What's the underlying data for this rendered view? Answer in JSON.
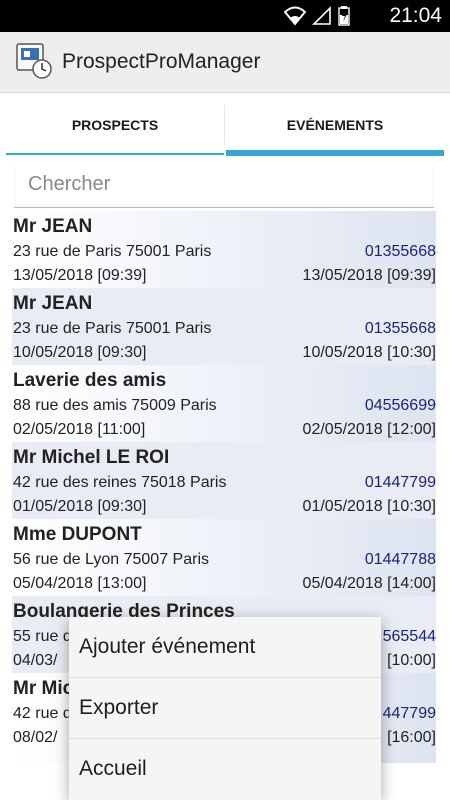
{
  "status_bar": {
    "time": "21:04",
    "icons": [
      "wifi-icon",
      "signal-icon",
      "battery-icon"
    ]
  },
  "app": {
    "title": "ProspectProManager"
  },
  "tabs": [
    {
      "label": "PROSPECTS",
      "selected": false
    },
    {
      "label": "EVÉNEMENTS",
      "selected": true
    }
  ],
  "search": {
    "placeholder": "Chercher",
    "value": ""
  },
  "events": [
    {
      "name": "Mr JEAN",
      "address": "23 rue de Paris 75001 Paris",
      "phone": "01355668",
      "start": "13/05/2018  [09:39]",
      "end": "13/05/2018  [09:39]"
    },
    {
      "name": "Mr JEAN",
      "address": "23 rue de Paris 75001 Paris",
      "phone": "01355668",
      "start": "10/05/2018  [09:30]",
      "end": "10/05/2018  [10:30]"
    },
    {
      "name": "Laverie des amis",
      "address": "88 rue des amis 75009 Paris",
      "phone": "04556699",
      "start": "02/05/2018  [11:00]",
      "end": "02/05/2018  [12:00]"
    },
    {
      "name": "Mr Michel LE ROI",
      "address": "42 rue des reines 75018 Paris",
      "phone": "01447799",
      "start": "01/05/2018  [09:30]",
      "end": "01/05/2018  [10:30]"
    },
    {
      "name": "Mme DUPONT",
      "address": "56 rue de Lyon 75007 Paris",
      "phone": "01447788",
      "start": "05/04/2018  [13:00]",
      "end": "05/04/2018  [14:00]"
    },
    {
      "name": "Boulangerie des Princes",
      "address": "55 rue d",
      "phone": "565544",
      "start": "04/03/",
      "end": "[10:00]"
    },
    {
      "name": "Mr Mic",
      "address": "42 rue d",
      "phone": "447799",
      "start": "08/02/",
      "end": "[16:00]"
    }
  ],
  "menu": {
    "items": [
      "Ajouter événement",
      "Exporter",
      "Accueil"
    ]
  },
  "colors": {
    "accent": "#35a4d6",
    "phone": "#1a237e",
    "row_alt": "#e9ecf4"
  }
}
